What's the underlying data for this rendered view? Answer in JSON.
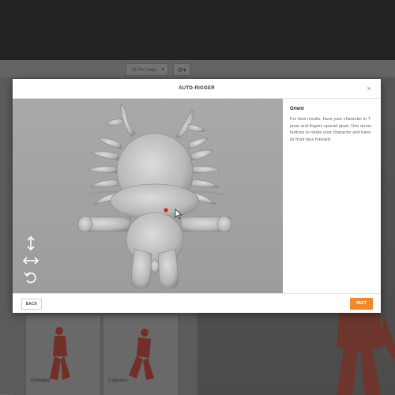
{
  "background": {
    "per_page_label": "18 Per page",
    "cards": [
      {
        "caption": "Defeated"
      },
      {
        "caption": "Capoeira"
      }
    ]
  },
  "modal": {
    "title": "AUTO-RIGGER",
    "close_symbol": "×",
    "info": {
      "heading": "Orient",
      "body": "For best results, have your character in T-pose and fingers spread apart. Use arrow buttons to rotate your character and have its front face forward."
    },
    "back_label": "BACK",
    "next_label": "NEXT"
  },
  "colors": {
    "accent": "#f0892c",
    "viewport_bg": "#a5a5a5",
    "marker": "#d21f1f"
  },
  "icons": [
    "vertical-arrow-icon",
    "horizontal-arrow-icon",
    "rotate-icon",
    "close-icon",
    "gear-icon",
    "chevron-down-icon",
    "mouse-cursor-icon"
  ]
}
